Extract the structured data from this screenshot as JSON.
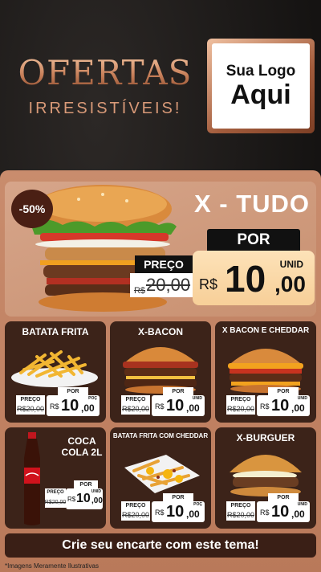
{
  "header": {
    "title": "OFERTAS",
    "subtitle": "IRRESISTÍVEIS!",
    "logo_line1": "Sua Logo",
    "logo_line2": "Aqui"
  },
  "featured": {
    "discount": "-50%",
    "name": "X - TUDO",
    "por_label": "POR",
    "preco_label": "PREÇO",
    "old_currency": "R$",
    "old_value": "20,00",
    "currency": "R$",
    "price_int": "10",
    "price_dec": ",00",
    "unit": "UNID"
  },
  "products": [
    {
      "name": "BATATA FRITA",
      "preco": "PREÇO",
      "por": "POR",
      "old": "R$20,00",
      "currency": "R$",
      "int": "10",
      "dec": ",00",
      "unit": "POÇ"
    },
    {
      "name": "X-BACON",
      "preco": "PREÇO",
      "por": "POR",
      "old": "R$20,00",
      "currency": "R$",
      "int": "10",
      "dec": ",00",
      "unit": "UNID"
    },
    {
      "name": "X BACON E CHEDDAR",
      "preco": "PREÇO",
      "por": "POR",
      "old": "R$20,00",
      "currency": "R$",
      "int": "10",
      "dec": ",00",
      "unit": "UNID"
    },
    {
      "name": "COCA COLA 2L",
      "preco": "PREÇO",
      "por": "POR",
      "old": "R$20,00",
      "currency": "R$",
      "int": "10",
      "dec": ",00",
      "unit": "UNID"
    },
    {
      "name": "BATATA FRITA COM CHEDDAR",
      "preco": "PREÇO",
      "por": "POR",
      "old": "R$20,00",
      "currency": "R$",
      "int": "10",
      "dec": ",00",
      "unit": "POÇ"
    },
    {
      "name": "X-BURGUER",
      "preco": "PREÇO",
      "por": "POR",
      "old": "R$20,00",
      "currency": "R$",
      "int": "10",
      "dec": ",00",
      "unit": "UNID"
    }
  ],
  "cta": "Crie seu encarte com este tema!",
  "disclaimer": "*Imagens Meramente Ilustrativas",
  "colors": {
    "accent": "#c8805a",
    "card_bg": "#3c2319",
    "panel_bg": "#c98c6d",
    "price_highlight": "#f7cf98"
  }
}
